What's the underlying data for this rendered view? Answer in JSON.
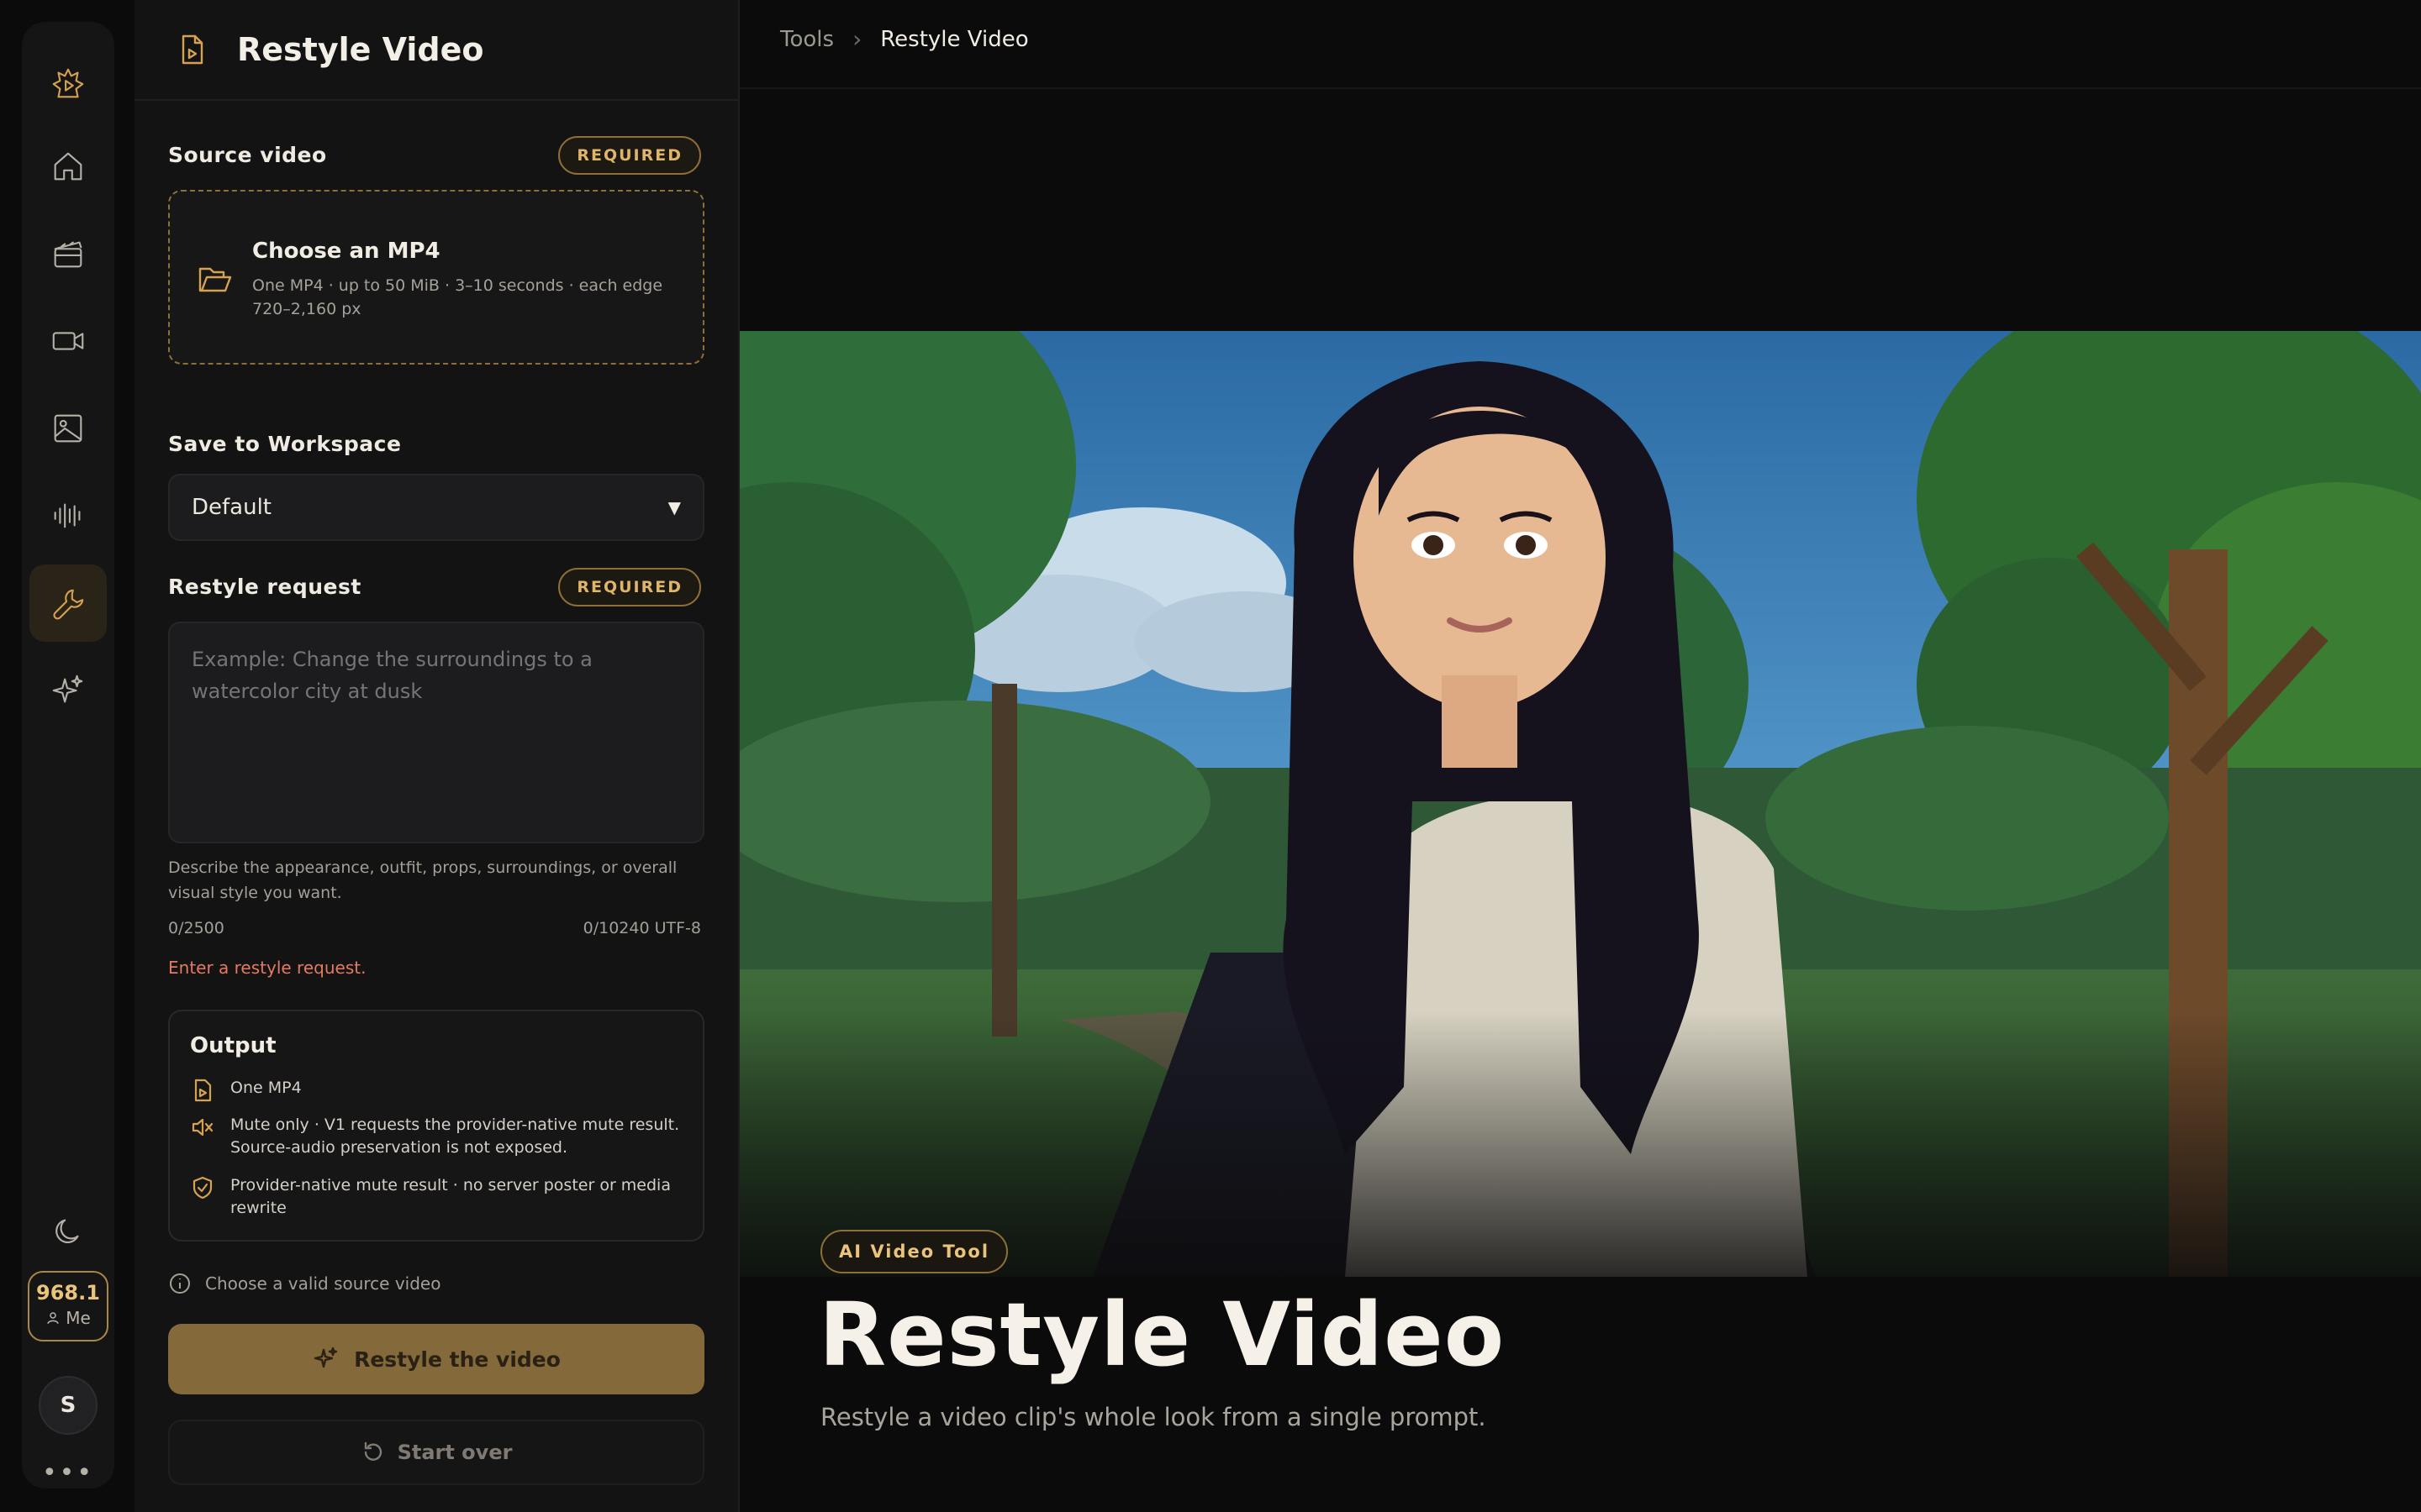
{
  "rail": {
    "items": [
      "logo",
      "home",
      "clapperboard",
      "video-camera",
      "image",
      "audio-waveform",
      "wrench",
      "sparkles"
    ],
    "active": "wrench",
    "credits": "968.1",
    "credits_owner": "Me",
    "avatar_initial": "S",
    "more": "•••"
  },
  "panel": {
    "title": "Restyle Video",
    "source": {
      "label": "Source video",
      "badge": "REQUIRED",
      "drop_title": "Choose an MP4",
      "drop_subtitle": "One MP4 · up to 50 MiB · 3–10 seconds · each edge 720–2,160 px"
    },
    "workspace": {
      "label": "Save to Workspace",
      "value": "Default"
    },
    "request": {
      "label": "Restyle request",
      "badge": "REQUIRED",
      "placeholder": "Example: Change the surroundings to a watercolor city at dusk",
      "value": "",
      "hint": "Describe the appearance, outfit, props, surroundings, or overall visual style you want.",
      "char_count": "0/2500",
      "byte_count": "0/10240 UTF-8",
      "error": "Enter a restyle request."
    },
    "output": {
      "title": "Output",
      "rows": [
        "One MP4",
        "Mute only · V1 requests the provider-native mute result. Source-audio preservation is not exposed.",
        "Provider-native mute result · no server poster or media rewrite"
      ]
    },
    "status": "Choose a valid source video",
    "primary_button": "Restyle the video",
    "secondary_button": "Start over"
  },
  "main": {
    "breadcrumb": [
      "Tools",
      "Restyle Video"
    ],
    "chip": "AI Video Tool",
    "title": "Restyle Video",
    "subtitle": "Restyle a video clip's whole look from a single prompt."
  },
  "colors": {
    "accent": "#d6a24f",
    "primary_button": "#84693a",
    "error": "#e57a60",
    "background": "#0b0b0c",
    "panel": "#131314"
  }
}
